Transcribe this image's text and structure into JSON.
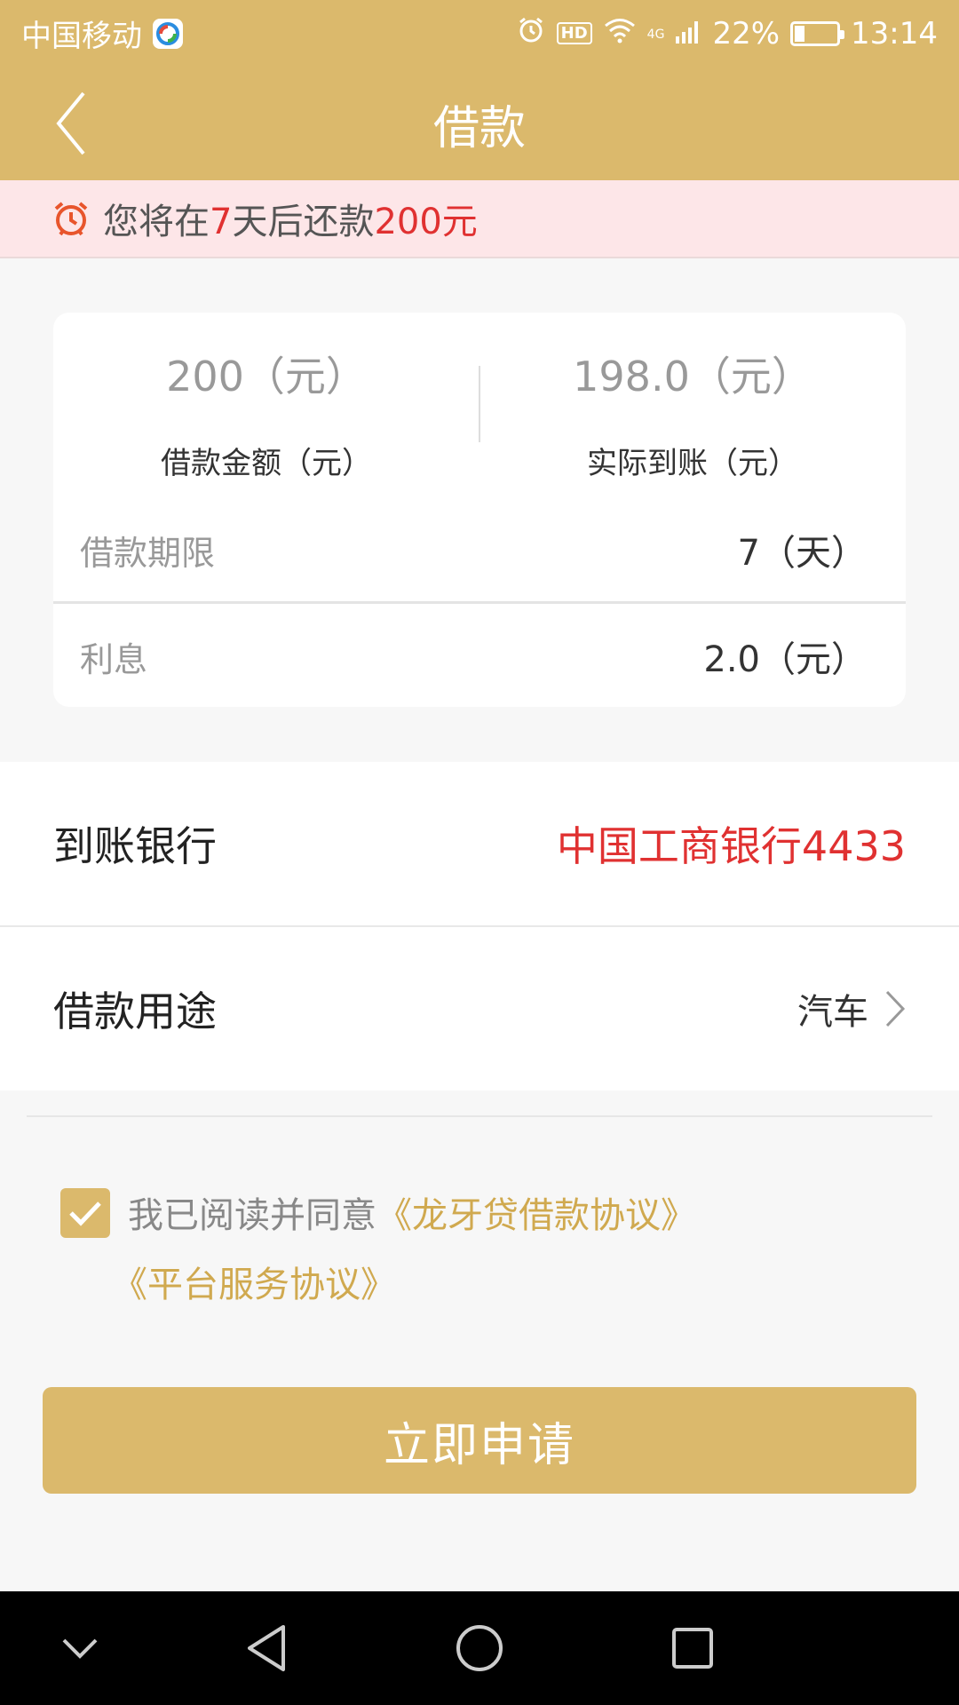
{
  "status_bar": {
    "carrier": "中国移动",
    "hd": "HD",
    "network": "4G",
    "battery": "22%",
    "battery_level": 0.22,
    "time": "13:14"
  },
  "header": {
    "title": "借款"
  },
  "notice": {
    "prefix": "您将在",
    "days": "7",
    "middle": "天后还款",
    "amount": "200元"
  },
  "summary": {
    "loan_amount_value": "200（元）",
    "loan_amount_label": "借款金额（元）",
    "received_value": "198.0（元）",
    "received_label": "实际到账（元）"
  },
  "details": {
    "term_label": "借款期限",
    "term_value": "7（天）",
    "interest_label": "利息",
    "interest_value": "2.0（元）"
  },
  "bank": {
    "label": "到账银行",
    "value": "中国工商银行4433"
  },
  "purpose": {
    "label": "借款用途",
    "value": "汽车"
  },
  "agreement": {
    "checked": true,
    "text": "我已阅读并同意",
    "link1": "《龙牙贷借款协议》",
    "link2": "《平台服务协议》"
  },
  "submit_label": "立即申请",
  "colors": {
    "brand": "#dbb96c",
    "accent_red": "#e03131",
    "notice_bg": "#fde6e8"
  }
}
